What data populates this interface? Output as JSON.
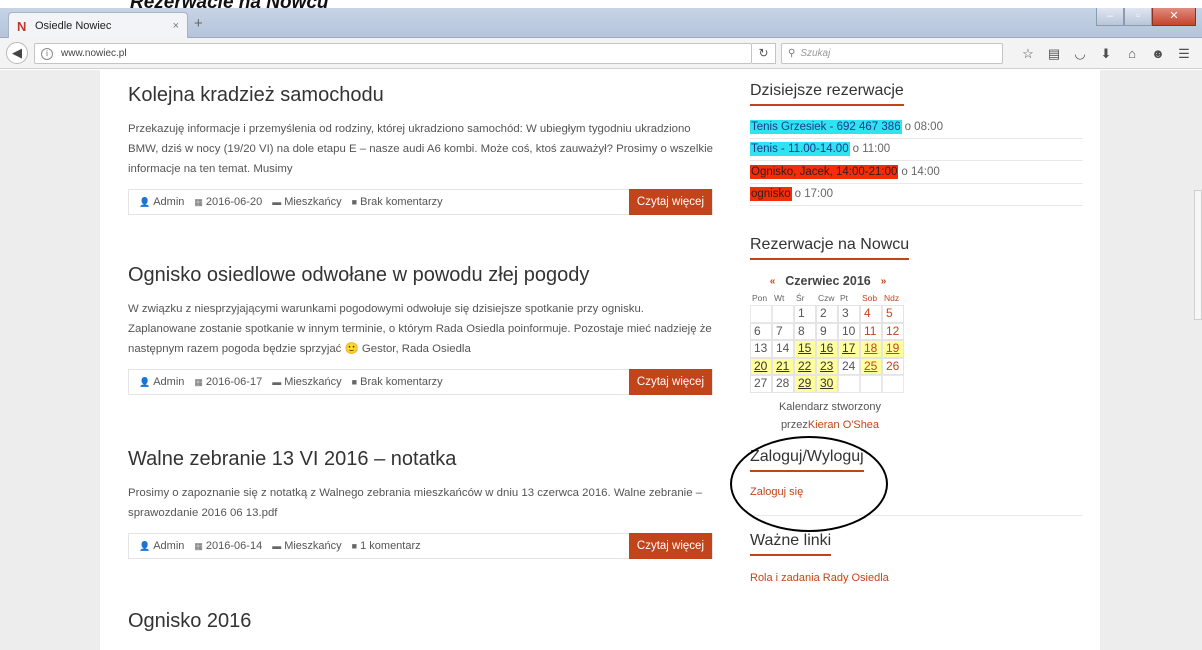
{
  "caption": "Rezerwacje na Nowcu",
  "browser": {
    "tab_title": "Osiedle Nowiec",
    "tab_close": "×",
    "new_tab": "+",
    "favicon": "N",
    "url": "www.nowiec.pl",
    "search_placeholder": "Szukaj",
    "win_min": "–",
    "win_max": "▫",
    "win_close": "✕",
    "toolbar_icons": [
      "star-icon",
      "reading-list-icon",
      "pocket-icon",
      "download-icon",
      "home-icon",
      "chat-icon",
      "menu-icon"
    ]
  },
  "posts": [
    {
      "title": "Kolejna kradzież samochodu",
      "excerpt": "Przekazuję informacje i przemyślenia od rodziny, której ukradziono samochód: W ubiegłym tygodniu ukradziono BMW, dziś w nocy (19/20 VI) na dole etapu E – nasze audi A6 kombi. Może coś, ktoś zauważył? Prosimy o wszelkie informacje na ten temat. Musimy",
      "author": "Admin",
      "date": "2016-06-20",
      "category": "Mieszkańcy",
      "comments": "Brak komentarzy",
      "read_more": "Czytaj więcej"
    },
    {
      "title": "Ognisko osiedlowe odwołane w powodu złej pogody",
      "excerpt": "W związku z niesprzyjającymi warunkami pogodowymi odwołuje się dzisiejsze spotkanie przy ognisku. Zaplanowane zostanie spotkanie w innym terminie, o którym Rada Osiedla poinformuje. Pozostaje mieć nadzieję że następnym razem pogoda będzie sprzyjać 🙂 Gestor, Rada Osiedla",
      "author": "Admin",
      "date": "2016-06-17",
      "category": "Mieszkańcy",
      "comments": "Brak komentarzy",
      "read_more": "Czytaj więcej"
    },
    {
      "title": "Walne zebranie 13 VI 2016 – notatka",
      "excerpt": "Prosimy o zapoznanie się z notatką z Walnego zebrania mieszkańców w dniu 13 czerwca 2016. Walne zebranie – sprawozdanie 2016 06 13.pdf",
      "author": "Admin",
      "date": "2016-06-14",
      "category": "Mieszkańcy",
      "comments": "1 komentarz",
      "read_more": "Czytaj więcej"
    },
    {
      "title": "Ognisko 2016"
    }
  ],
  "sidebar": {
    "today_title": "Dzisiejsze rezerwacje",
    "reservations": [
      {
        "name": "Tenis Grzesiek - 692 467 386",
        "time": "o 08:00",
        "color": "#2fe3f0"
      },
      {
        "name": "Tenis - 11.00-14.00",
        "time": "o 11:00",
        "color": "#2fe3f0"
      },
      {
        "name": "Ognisko, Jacek, 14:00-21:00",
        "time": "o 14:00",
        "color": "#f22e0a"
      },
      {
        "name": "ognisko",
        "time": "o 17:00",
        "color": "#f22e0a"
      }
    ],
    "calendar_title": "Rezerwacje na Nowcu",
    "calendar": {
      "prev": "«",
      "month": "Czerwiec 2016",
      "next": "»",
      "dow": [
        "Pon",
        "Wt",
        "Śr",
        "Czw",
        "Pt",
        "Sob",
        "Ndz"
      ],
      "weeks": [
        [
          "",
          "",
          "1",
          "2",
          "3",
          "4",
          "5"
        ],
        [
          "6",
          "7",
          "8",
          "9",
          "10",
          "11",
          "12"
        ],
        [
          "13",
          "14",
          "15",
          "16",
          "17",
          "18",
          "19"
        ],
        [
          "20",
          "21",
          "22",
          "23",
          "24",
          "25",
          "26"
        ],
        [
          "27",
          "28",
          "29",
          "30",
          "",
          "",
          ""
        ]
      ],
      "highlighted": [
        "15",
        "16",
        "17",
        "18",
        "19",
        "20",
        "21",
        "22",
        "23",
        "25",
        "29",
        "30"
      ]
    },
    "credit_line1": "Kalendarz stworzony",
    "credit_prefix": "przez",
    "credit_author": "Kieran O'Shea",
    "login_title": "Zaloguj/Wyloguj",
    "login_link": "Zaloguj się",
    "links_title": "Ważne linki",
    "links_first": "Rola i zadania Rady Osiedla"
  }
}
